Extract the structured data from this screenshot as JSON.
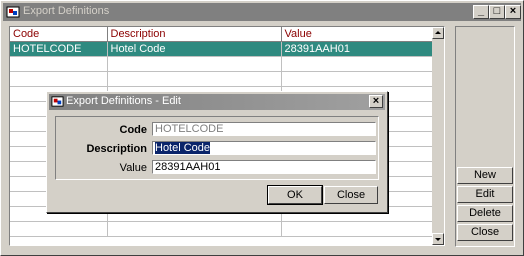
{
  "window": {
    "title": "Export Definitions",
    "minimize_glyph": "_",
    "maximize_glyph": "□",
    "close_glyph": "×"
  },
  "grid": {
    "columns": [
      "Code",
      "Description",
      "Value"
    ],
    "rows": [
      {
        "code": "HOTELCODE",
        "description": "Hotel Code",
        "value": "28391AAH01"
      }
    ],
    "empty_rows": 12,
    "selected_color": "#2f8a80",
    "header_color": "#8b0000"
  },
  "side_buttons": {
    "new": "New",
    "edit": "Edit",
    "delete": "Delete",
    "close": "Close"
  },
  "dialog": {
    "title": "Export Definitions - Edit",
    "close_glyph": "×",
    "fields": {
      "code_label": "Code",
      "code_value": "HOTELCODE",
      "description_label": "Description",
      "description_value": "Hotel Code",
      "value_label": "Value",
      "value_value": "28391AAH01"
    },
    "ok_label": "OK",
    "close_label": "Close"
  }
}
